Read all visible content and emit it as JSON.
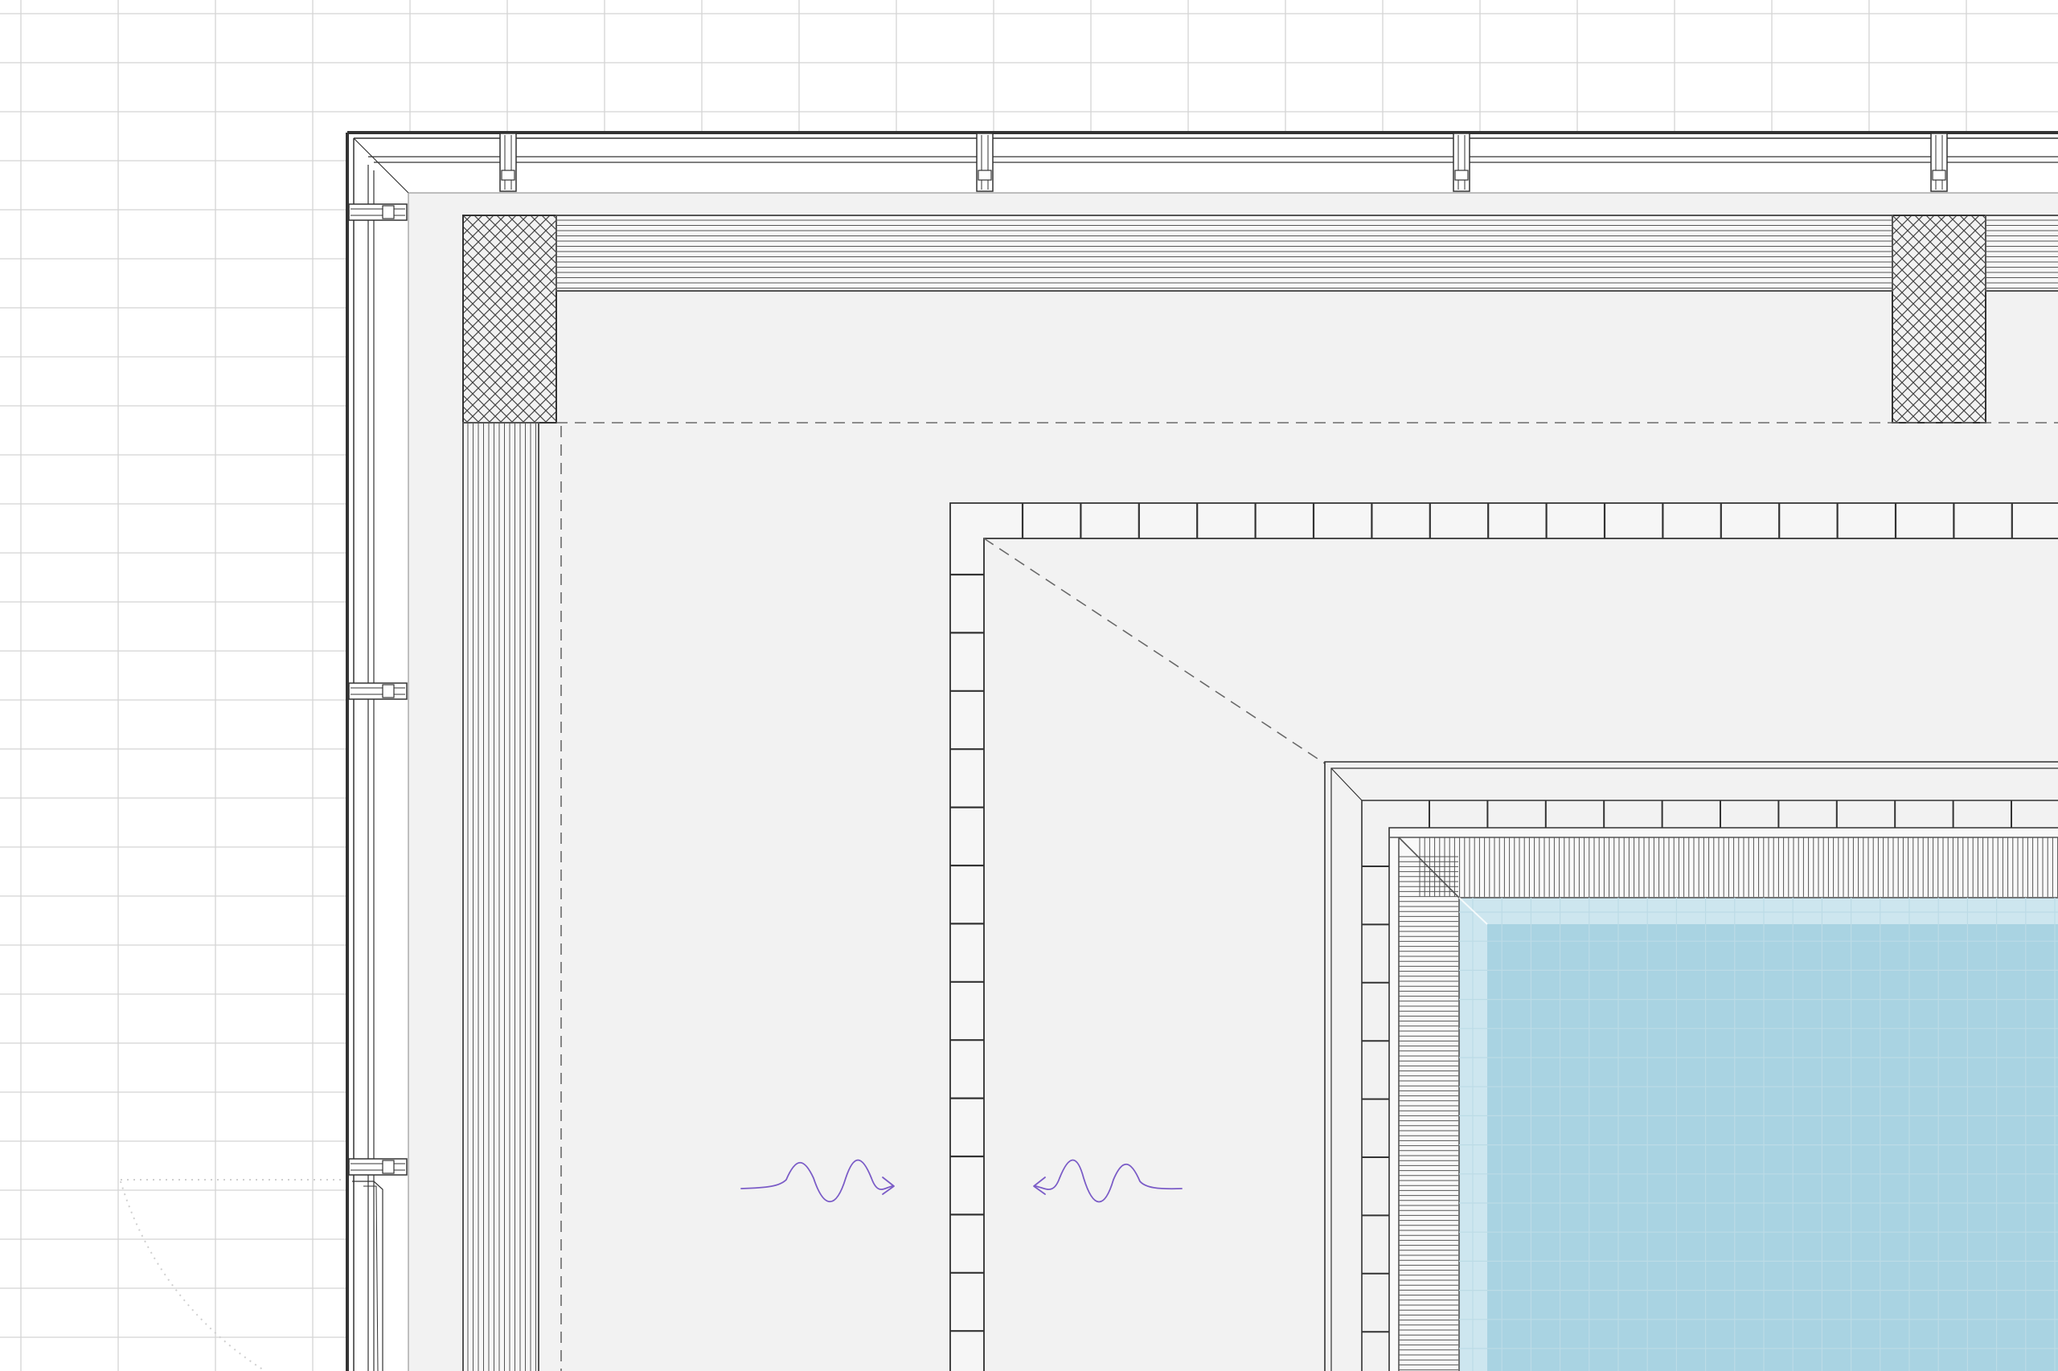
{
  "drawing": {
    "kind": "architectural-plan-detail",
    "colors": {
      "background": "#ffffff",
      "grid": "#d4d4d4",
      "slab": "#f2f2f2",
      "line": "#333333",
      "dash": "#6a6a6a",
      "pool_water": "#a9d3e2",
      "pool_edge": "#cde6ef",
      "pool_grid": "#bcdbe6",
      "airflow": "#7b5cc7"
    },
    "icons": [
      "airflow-arrow-right-icon",
      "airflow-arrow-left-icon"
    ]
  }
}
